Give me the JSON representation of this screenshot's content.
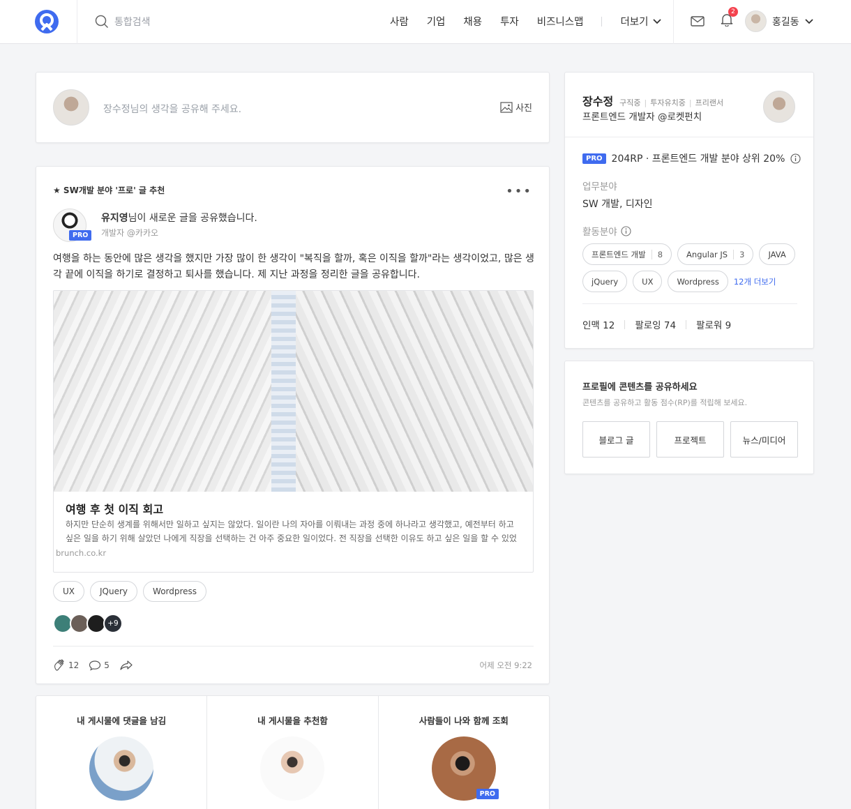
{
  "header": {
    "search_placeholder": "통합검색",
    "nav": [
      "사람",
      "기업",
      "채용",
      "투자",
      "비즈니스맵"
    ],
    "more_label": "더보기",
    "notification_count": "2",
    "user_name": "홍길동"
  },
  "composer": {
    "placeholder": "장수정님의 생각을 공유해 주세요.",
    "photo_label": "사진"
  },
  "post": {
    "recommendation": "★ SW개발 분야 '프로' 글 추천",
    "author_name": "유지영",
    "author_action": "님이 새로운 글을 공유했습니다.",
    "author_title": "개발자 @카카오",
    "pro_badge": "PRO",
    "text": "여행을 하는 동안에 많은 생각을 했지만 가장 많이 한 생각이 \"복직을 할까, 혹은 이직을 할까\"라는 생각이었고, 많은 생각 끝에 이직을 하기로 결정하고 퇴사를 했습니다. 제 지난 과정을 정리한 글을 공유합니다.",
    "link": {
      "title": "여행 후 첫 이직 회고",
      "description": "하지만 단순히 생계를 위해서만 일하고 싶지는 않았다. 일이란 나의 자아를 이뤄내는 과정 중에 하나라고 생각했고, 예전부터 하고 싶은 일을 하기 위해 살았던 나에게 직장을 선택하는 건 아주 중요한 일이었다. 전 직장을 선택한 이유도 하고 싶은 일을 할 수 있었기에 선…",
      "url": "brunch.co.kr"
    },
    "tags": [
      "UX",
      "JQuery",
      "Wordpress"
    ],
    "likers_more": "+9",
    "claps": "12",
    "comments": "5",
    "time": "어제 오전 9:22"
  },
  "strip": [
    {
      "label": "내 게시물에 댓글을 남김"
    },
    {
      "label": "내 게시물을 추천함"
    },
    {
      "label": "사람들이 나와 함께 조회",
      "pro": "PRO"
    }
  ],
  "profile": {
    "name": "장수정",
    "statuses": [
      "구직중",
      "투자유치중",
      "프리랜서"
    ],
    "role": "프론트엔드 개발자 @로켓펀치",
    "pro": "PRO",
    "rp_text": "204RP · 프론트엔드 개발 분야 상위 20%",
    "work_label": "업무분야",
    "work_value": "SW 개발, 디자인",
    "activity_label": "활동분야",
    "chips": [
      {
        "label": "프론트엔드 개발",
        "count": "8"
      },
      {
        "label": "Angular JS",
        "count": "3"
      },
      {
        "label": "JAVA",
        "count": ""
      },
      {
        "label": "jQuery",
        "count": ""
      },
      {
        "label": "UX",
        "count": ""
      },
      {
        "label": "Wordpress",
        "count": ""
      }
    ],
    "chips_more": "12개 더보기",
    "stats": [
      "인맥 12",
      "팔로잉 74",
      "팔로워 9"
    ]
  },
  "share": {
    "title": "프로필에 콘텐츠를 공유하세요",
    "subtitle": "콘텐츠를 공유하고 활동 점수(RP)를 적립해 보세요.",
    "buttons": [
      "블로그 글",
      "프로젝트",
      "뉴스/미디어"
    ]
  },
  "colors": {
    "accent": "#3f6bef",
    "badge": "#f4424e"
  }
}
